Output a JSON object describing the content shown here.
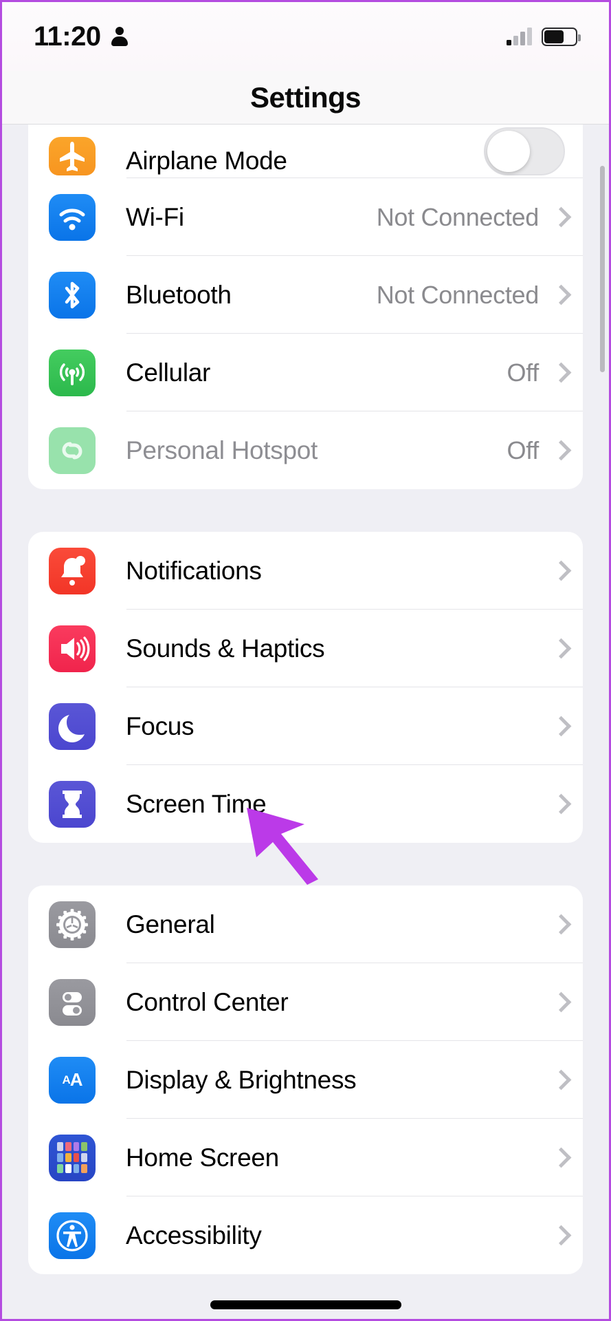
{
  "status_bar": {
    "time": "11:20",
    "person_icon": "person-icon",
    "signal_icon": "cellular-signal-icon",
    "battery_icon": "battery-icon"
  },
  "nav": {
    "title": "Settings"
  },
  "annotation": {
    "arrow_color": "#bb3ae8",
    "points_to": "Screen Time"
  },
  "groups": [
    {
      "id": "connectivity",
      "rows": [
        {
          "label": "Airplane Mode",
          "icon": "airplane-icon",
          "accessory": "toggle",
          "toggle_on": false,
          "value": "",
          "dim": false,
          "clipped": true
        },
        {
          "label": "Wi-Fi",
          "icon": "wifi-icon",
          "accessory": "chevron",
          "value": "Not Connected",
          "dim": false,
          "clipped": false
        },
        {
          "label": "Bluetooth",
          "icon": "bluetooth-icon",
          "accessory": "chevron",
          "value": "Not Connected",
          "dim": false,
          "clipped": false
        },
        {
          "label": "Cellular",
          "icon": "cellular-icon",
          "accessory": "chevron",
          "value": "Off",
          "dim": false,
          "clipped": false
        },
        {
          "label": "Personal Hotspot",
          "icon": "hotspot-icon",
          "accessory": "chevron",
          "value": "Off",
          "dim": true,
          "clipped": false
        }
      ]
    },
    {
      "id": "alerts",
      "rows": [
        {
          "label": "Notifications",
          "icon": "notifications-bell-icon",
          "accessory": "chevron",
          "value": "",
          "dim": false,
          "clipped": false
        },
        {
          "label": "Sounds & Haptics",
          "icon": "speaker-icon",
          "accessory": "chevron",
          "value": "",
          "dim": false,
          "clipped": false
        },
        {
          "label": "Focus",
          "icon": "moon-icon",
          "accessory": "chevron",
          "value": "",
          "dim": false,
          "clipped": false
        },
        {
          "label": "Screen Time",
          "icon": "hourglass-icon",
          "accessory": "chevron",
          "value": "",
          "dim": false,
          "clipped": false
        }
      ]
    },
    {
      "id": "system",
      "rows": [
        {
          "label": "General",
          "icon": "gear-icon",
          "accessory": "chevron",
          "value": "",
          "dim": false,
          "clipped": false
        },
        {
          "label": "Control Center",
          "icon": "toggles-icon",
          "accessory": "chevron",
          "value": "",
          "dim": false,
          "clipped": false
        },
        {
          "label": "Display & Brightness",
          "icon": "text-size-aa-icon",
          "accessory": "chevron",
          "value": "",
          "dim": false,
          "clipped": false
        },
        {
          "label": "Home Screen",
          "icon": "home-screen-grid-icon",
          "accessory": "chevron",
          "value": "",
          "dim": false,
          "clipped": false
        },
        {
          "label": "Accessibility",
          "icon": "accessibility-icon",
          "accessory": "chevron",
          "value": "",
          "dim": false,
          "clipped": false
        }
      ]
    }
  ]
}
